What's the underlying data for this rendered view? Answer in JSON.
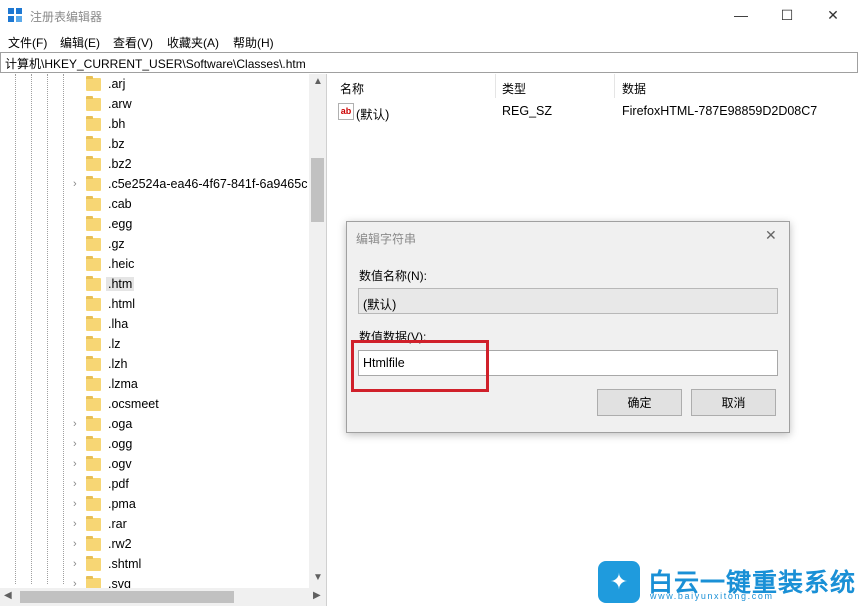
{
  "window": {
    "title": "注册表编辑器",
    "minimize": "—",
    "maximize": "☐",
    "close": "✕"
  },
  "menu": [
    "文件(F)",
    "编辑(E)",
    "查看(V)",
    "收藏夹(A)",
    "帮助(H)"
  ],
  "address": "计算机\\HKEY_CURRENT_USER\\Software\\Classes\\.htm",
  "tree": {
    "items": [
      ".arj",
      ".arw",
      ".bh",
      ".bz",
      ".bz2",
      ".c5e2524a-ea46-4f67-841f-6a9465c",
      ".cab",
      ".egg",
      ".gz",
      ".heic",
      ".htm",
      ".html",
      ".lha",
      ".lz",
      ".lzh",
      ".lzma",
      ".ocsmeet",
      ".oga",
      ".ogg",
      ".ogv",
      ".pdf",
      ".pma",
      ".rar",
      ".rw2",
      ".shtml",
      ".svg"
    ],
    "expandable": [
      ".c5e2524a-ea46-4f67-841f-6a9465c",
      ".oga",
      ".ogg",
      ".ogv",
      ".pdf",
      ".pma",
      ".rar",
      ".rw2",
      ".shtml",
      ".svg"
    ],
    "selected": ".htm"
  },
  "list": {
    "columns": {
      "name": "名称",
      "type": "类型",
      "data": "数据"
    },
    "rows": [
      {
        "icon": "ab",
        "name": "(默认)",
        "type": "REG_SZ",
        "data": "FirefoxHTML-787E98859D2D08C7"
      }
    ]
  },
  "dialog": {
    "title": "编辑字符串",
    "close": "✕",
    "name_label": "数值名称(N):",
    "name_value": "(默认)",
    "data_label": "数值数据(V):",
    "data_value": "Htmlfile",
    "ok": "确定",
    "cancel": "取消"
  },
  "watermark": {
    "main": "白云一键重装系统",
    "url": "www.baiyunxitong.com"
  }
}
